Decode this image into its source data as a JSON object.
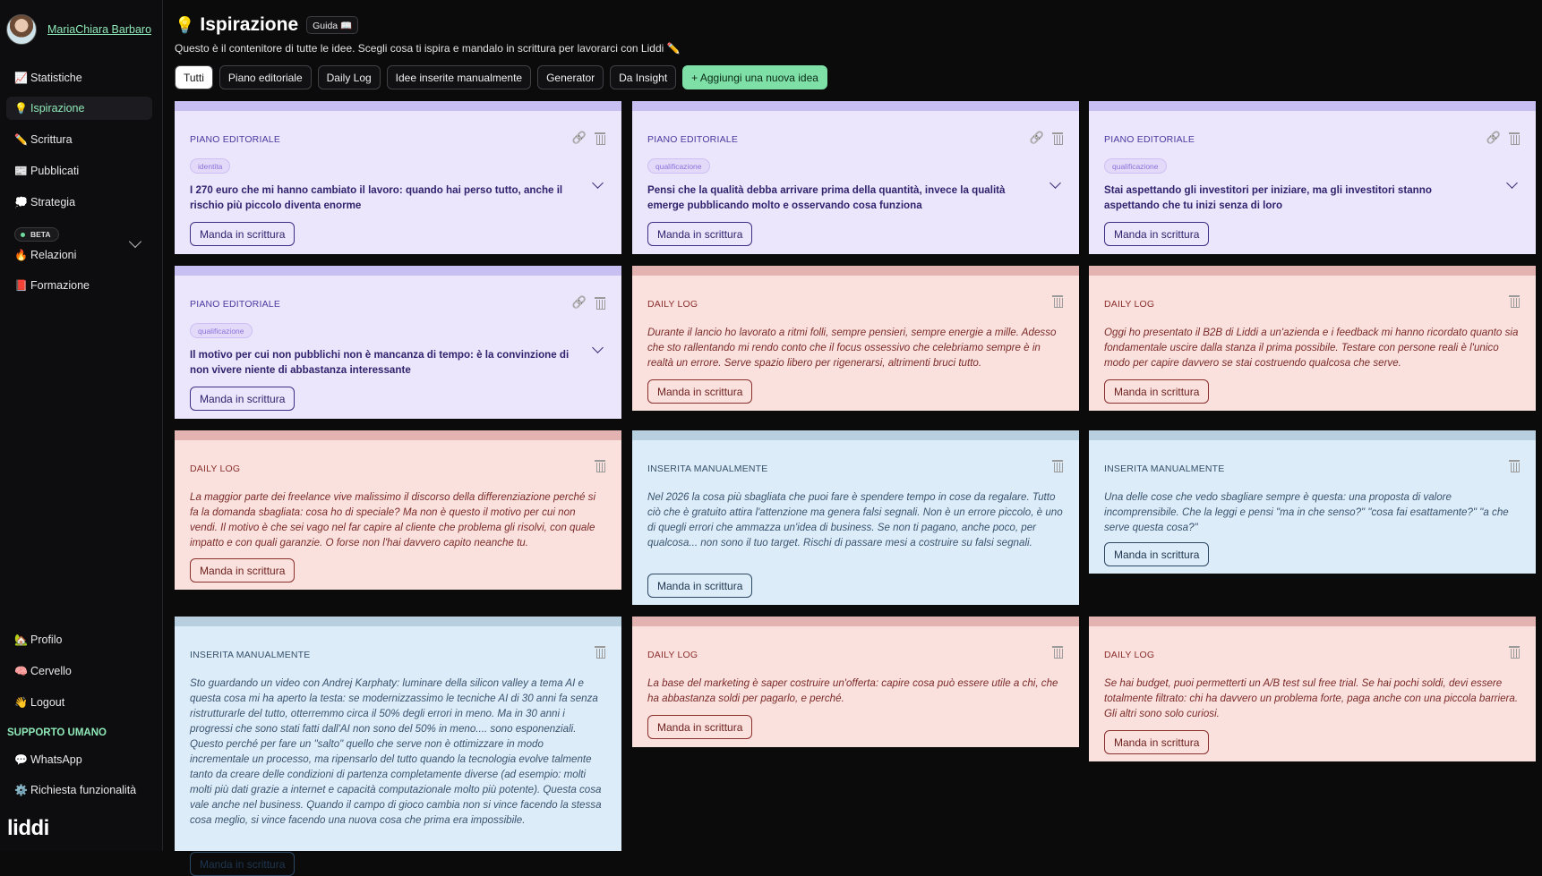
{
  "user": {
    "name": "MariaChiara Barbaro"
  },
  "nav": {
    "main": [
      {
        "icon": "📈",
        "label": "Statistiche"
      },
      {
        "icon": "💡",
        "label": "Ispirazione"
      },
      {
        "icon": "✏️",
        "label": "Scrittura"
      },
      {
        "icon": "📰",
        "label": "Pubblicati"
      },
      {
        "icon": "💭",
        "label": "Strategia"
      },
      {
        "icon": "🔥",
        "label": "Relazioni"
      },
      {
        "icon": "📕",
        "label": "Formazione"
      }
    ],
    "beta_label": "BETA",
    "bottom": [
      {
        "icon": "🏡",
        "label": "Profilo"
      },
      {
        "icon": "🧠",
        "label": "Cervello"
      },
      {
        "icon": "👋",
        "label": "Logout"
      }
    ],
    "support_title": "SUPPORTO UMANO",
    "support": [
      {
        "icon": "💬",
        "label": "WhatsApp"
      },
      {
        "icon": "⚙️",
        "label": "Richiesta funzionalità"
      }
    ]
  },
  "brand": "liddi",
  "header": {
    "icon": "💡",
    "title": "Ispirazione",
    "guide_label": "Guida 📖",
    "subtitle": "Questo è il contenitore di tutte le idee. Scegli cosa ti ispira e mandalo in scrittura per lavorarci con Liddi ✏️"
  },
  "filters": [
    "Tutti",
    "Piano editoriale",
    "Daily Log",
    "Idee inserite manualmente",
    "Generator",
    "Da Insight",
    "+ Aggiungi una nuova idea"
  ],
  "send_label": "Manda in scrittura",
  "cards": [
    {
      "category": "PIANO EDITORIALE",
      "tag": "identita",
      "text": "I 270 euro che mi hanno cambiato il lavoro: quando hai perso tutto, anche il rischio più piccolo diventa enorme"
    },
    {
      "category": "PIANO EDITORIALE",
      "tag": "qualificazione",
      "text": "Pensi che la qualità debba arrivare prima della quantità, invece la qualità emerge pubblicando molto e osservando cosa funziona"
    },
    {
      "category": "PIANO EDITORIALE",
      "tag": "qualificazione",
      "text": "Stai aspettando gli investitori per iniziare, ma gli investitori stanno aspettando che tu inizi senza di loro"
    },
    {
      "category": "PIANO EDITORIALE",
      "tag": "qualificazione",
      "text": "Il motivo per cui non pubblichi non è mancanza di tempo: è la convinzione di non vivere niente di abbastanza interessante"
    },
    {
      "category": "DAILY LOG",
      "text": "Durante il lancio ho lavorato a ritmi folli, sempre pensieri, sempre energie a mille. Adesso che sto rallentando mi rendo conto che il focus ossessivo che celebriamo sempre è in realtà un errore. Serve spazio libero per rigenerarsi, altrimenti bruci tutto."
    },
    {
      "category": "DAILY LOG",
      "text": "Oggi ho presentato il B2B di Liddi a un'azienda e i feedback mi hanno ricordato quanto sia fondamentale uscire dalla stanza il prima possibile. Testare con persone reali è l'unico modo per capire davvero se stai costruendo qualcosa che serve."
    },
    {
      "category": "DAILY LOG",
      "text": "La maggior parte dei freelance vive malissimo il discorso della differenziazione perché si fa la domanda sbagliata: cosa ho di speciale? Ma non è questo il motivo per cui non vendi. Il motivo è che sei vago nel far capire al cliente che problema gli risolvi, con quale impatto e con quali garanzie. O forse non l'hai davvero capito neanche tu."
    },
    {
      "category": "INSERITA MANUALMENTE",
      "text": "Nel 2026 la cosa più sbagliata che puoi fare è spendere tempo in cose da regalare. Tutto ciò che è gratuito attira l'attenzione ma genera falsi segnali. Non è un errore piccolo, è uno di quegli errori che ammazza un'idea di business. Se non ti pagano, anche poco, per qualcosa... non sono il tuo target. Rischi di passare mesi a costruire su falsi segnali."
    },
    {
      "category": "INSERITA MANUALMENTE",
      "text": "Una delle cose che vedo sbagliare sempre è questa: una proposta di valore incomprensibile. Che la leggi e pensi \"ma in che senso?\" \"cosa fai esattamente?\" \"a che serve questa cosa?\""
    },
    {
      "category": "INSERITA MANUALMENTE",
      "text": "Sto guardando un video con Andrej Karphaty: luminare della silicon valley a tema AI e questa cosa mi ha aperto la testa: se modernizzassimo le tecniche AI di 30 anni fa senza ristrutturarle del tutto, otterremmo circa il 50% degli errori in meno. Ma in 30 anni i progressi che sono stati fatti dall'AI non sono del 50% in meno.... sono esponenziali. Questo perché per fare un \"salto\" quello che serve non è ottimizzare in modo incrementale un processo, ma ripensarlo del tutto quando la tecnologia evolve talmente tanto da creare delle condizioni di partenza completamente diverse (ad esempio: molti molti più dati grazie a internet e capacità computazionale molto più potente). Questa cosa vale anche nel business. Quando il campo di gioco cambia non si vince facendo la stessa cosa meglio, si vince facendo una nuova cosa che prima era impossibile."
    },
    {
      "category": "DAILY LOG",
      "text": "La base del marketing è saper costruire un'offerta: capire cosa può essere utile a chi, che ha abbastanza soldi per pagarlo, e perché."
    },
    {
      "category": "DAILY LOG",
      "text": "Se hai budget, puoi permetterti un A/B test sul free trial. Se hai pochi soldi, devi essere totalmente filtrato: chi ha davvero un problema forte, paga anche con una piccola barriera. Gli altri sono solo curiosi."
    }
  ]
}
